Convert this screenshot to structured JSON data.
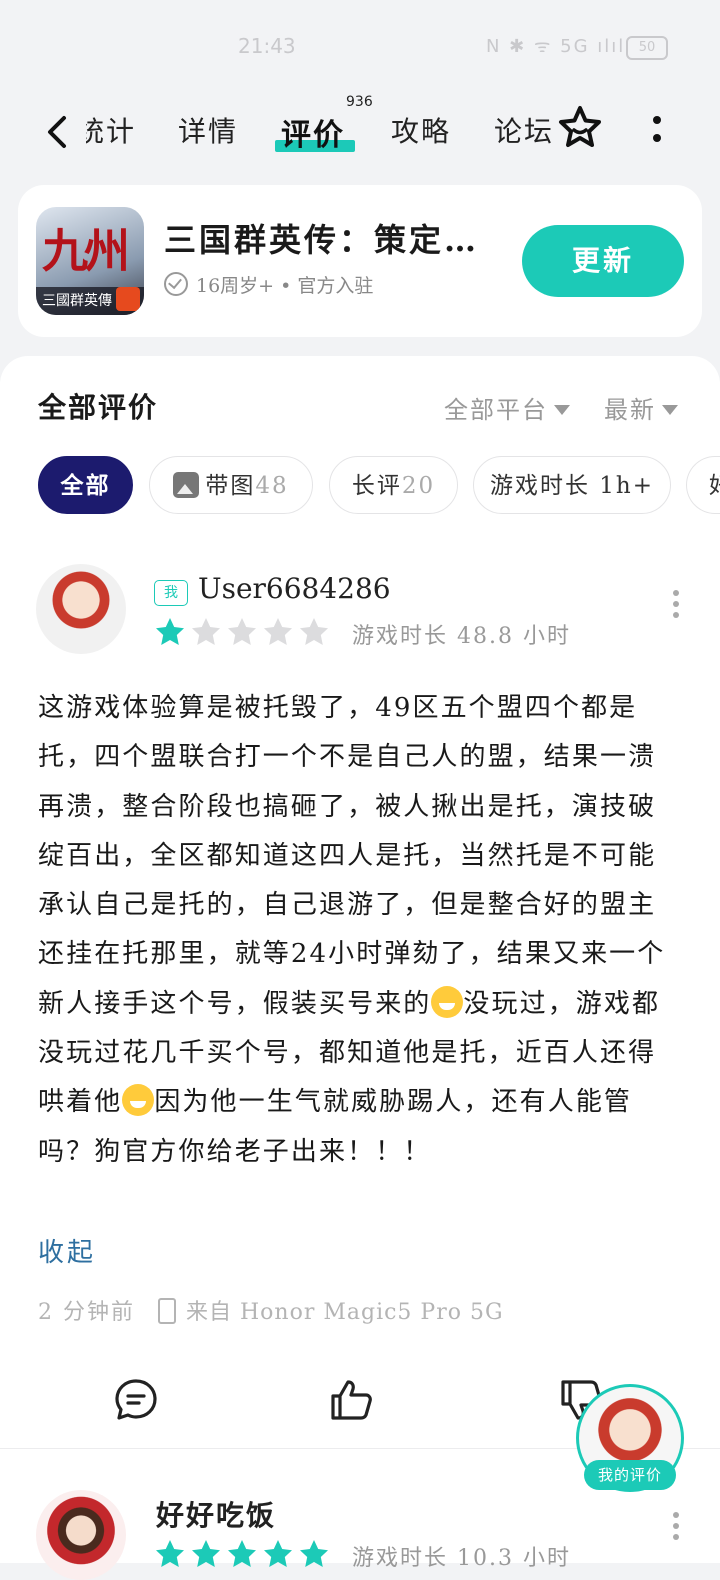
{
  "status": {
    "time": "21:43",
    "icons": "N ✱ ᯤ 5G ılıl",
    "battery": "50"
  },
  "nav": {
    "tabs": [
      {
        "label": "统计"
      },
      {
        "label": "详情"
      },
      {
        "label": "评价"
      },
      {
        "label": "攻略"
      },
      {
        "label": "论坛"
      }
    ],
    "review_badge": "936",
    "active_tab": "评价"
  },
  "app": {
    "title": "三国群英传：策定…",
    "icon_text": "九州",
    "icon_sub": "三國群英傳",
    "meta": "16周岁+ • 官方入驻",
    "update_label": "更新",
    "accent": "#1ccab7"
  },
  "reviews_header": {
    "title": "全部评价",
    "platform_filter": "全部平台",
    "sort_filter": "最新"
  },
  "chips": [
    {
      "label": "全部",
      "count": ""
    },
    {
      "label": "带图",
      "count": "48"
    },
    {
      "label": "长评",
      "count": "20"
    },
    {
      "label": "游戏时长 1h+",
      "count": ""
    },
    {
      "label": "好",
      "count": ""
    }
  ],
  "review1": {
    "me_tag": "我",
    "username": "User6684286",
    "rating": 1,
    "max_rating": 5,
    "playtime": "游戏时长 48.8 小时",
    "text_part1": "这游戏体验算是被托毁了，49区五个盟四个都是托，四个盟联合打一个不是自己人的盟，结果一溃再溃，整合阶段也搞砸了，被人揪出是托，演技破绽百出，全区都知道这四人是托，当然托是不可能承认自己是托的，自己退游了，但是整合好的盟主还挂在托那里，就等24小时弹劾了，结果又来一个新人接手这个号，假装买号来的",
    "text_part2": "没玩过，游戏都没玩过花几千买个号，都知道他是托，近百人还得哄着他",
    "text_part3": "因为他一生气就威胁踢人，还有人能管吗？狗官方你给老子出来！！！",
    "collapse_label": "收起",
    "time_ago": "2 分钟前",
    "device": "来自 Honor Magic5 Pro 5G"
  },
  "review2": {
    "username": "好好吃饭",
    "rating": 5,
    "max_rating": 5,
    "playtime": "游戏时长 10.3 小时"
  },
  "floating": {
    "label": "我的评价"
  }
}
